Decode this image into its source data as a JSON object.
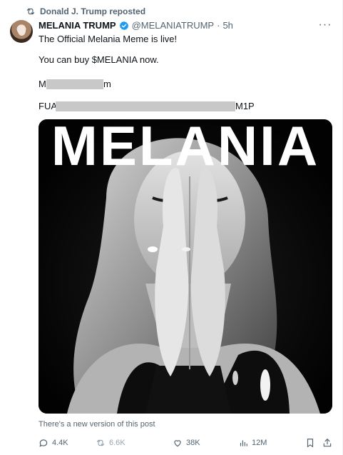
{
  "repost": {
    "label": "Donald J. Trump reposted",
    "icon": "repost-icon"
  },
  "author": {
    "name": "MELANIA TRUMP",
    "handle": "@MELANIATRUMP",
    "separator": "·",
    "time": "5h",
    "verified_color": "#1d9bf0"
  },
  "post": {
    "line1": "The Official Melania Meme is live!",
    "line2": "You can buy $MELANIA now.",
    "line3_prefix": "M",
    "line3_suffix": "m",
    "line4_prefix": "FUA",
    "line4_suffix": "M1P"
  },
  "media": {
    "overlay_text": "MELANIA"
  },
  "notice": "There's a new version of this post",
  "actions": {
    "replies": "4.4K",
    "reposts": "6.6K",
    "likes": "38K",
    "views": "12M"
  },
  "colors": {
    "secondary_text": "#536471",
    "accent": "#1d9bf0"
  }
}
